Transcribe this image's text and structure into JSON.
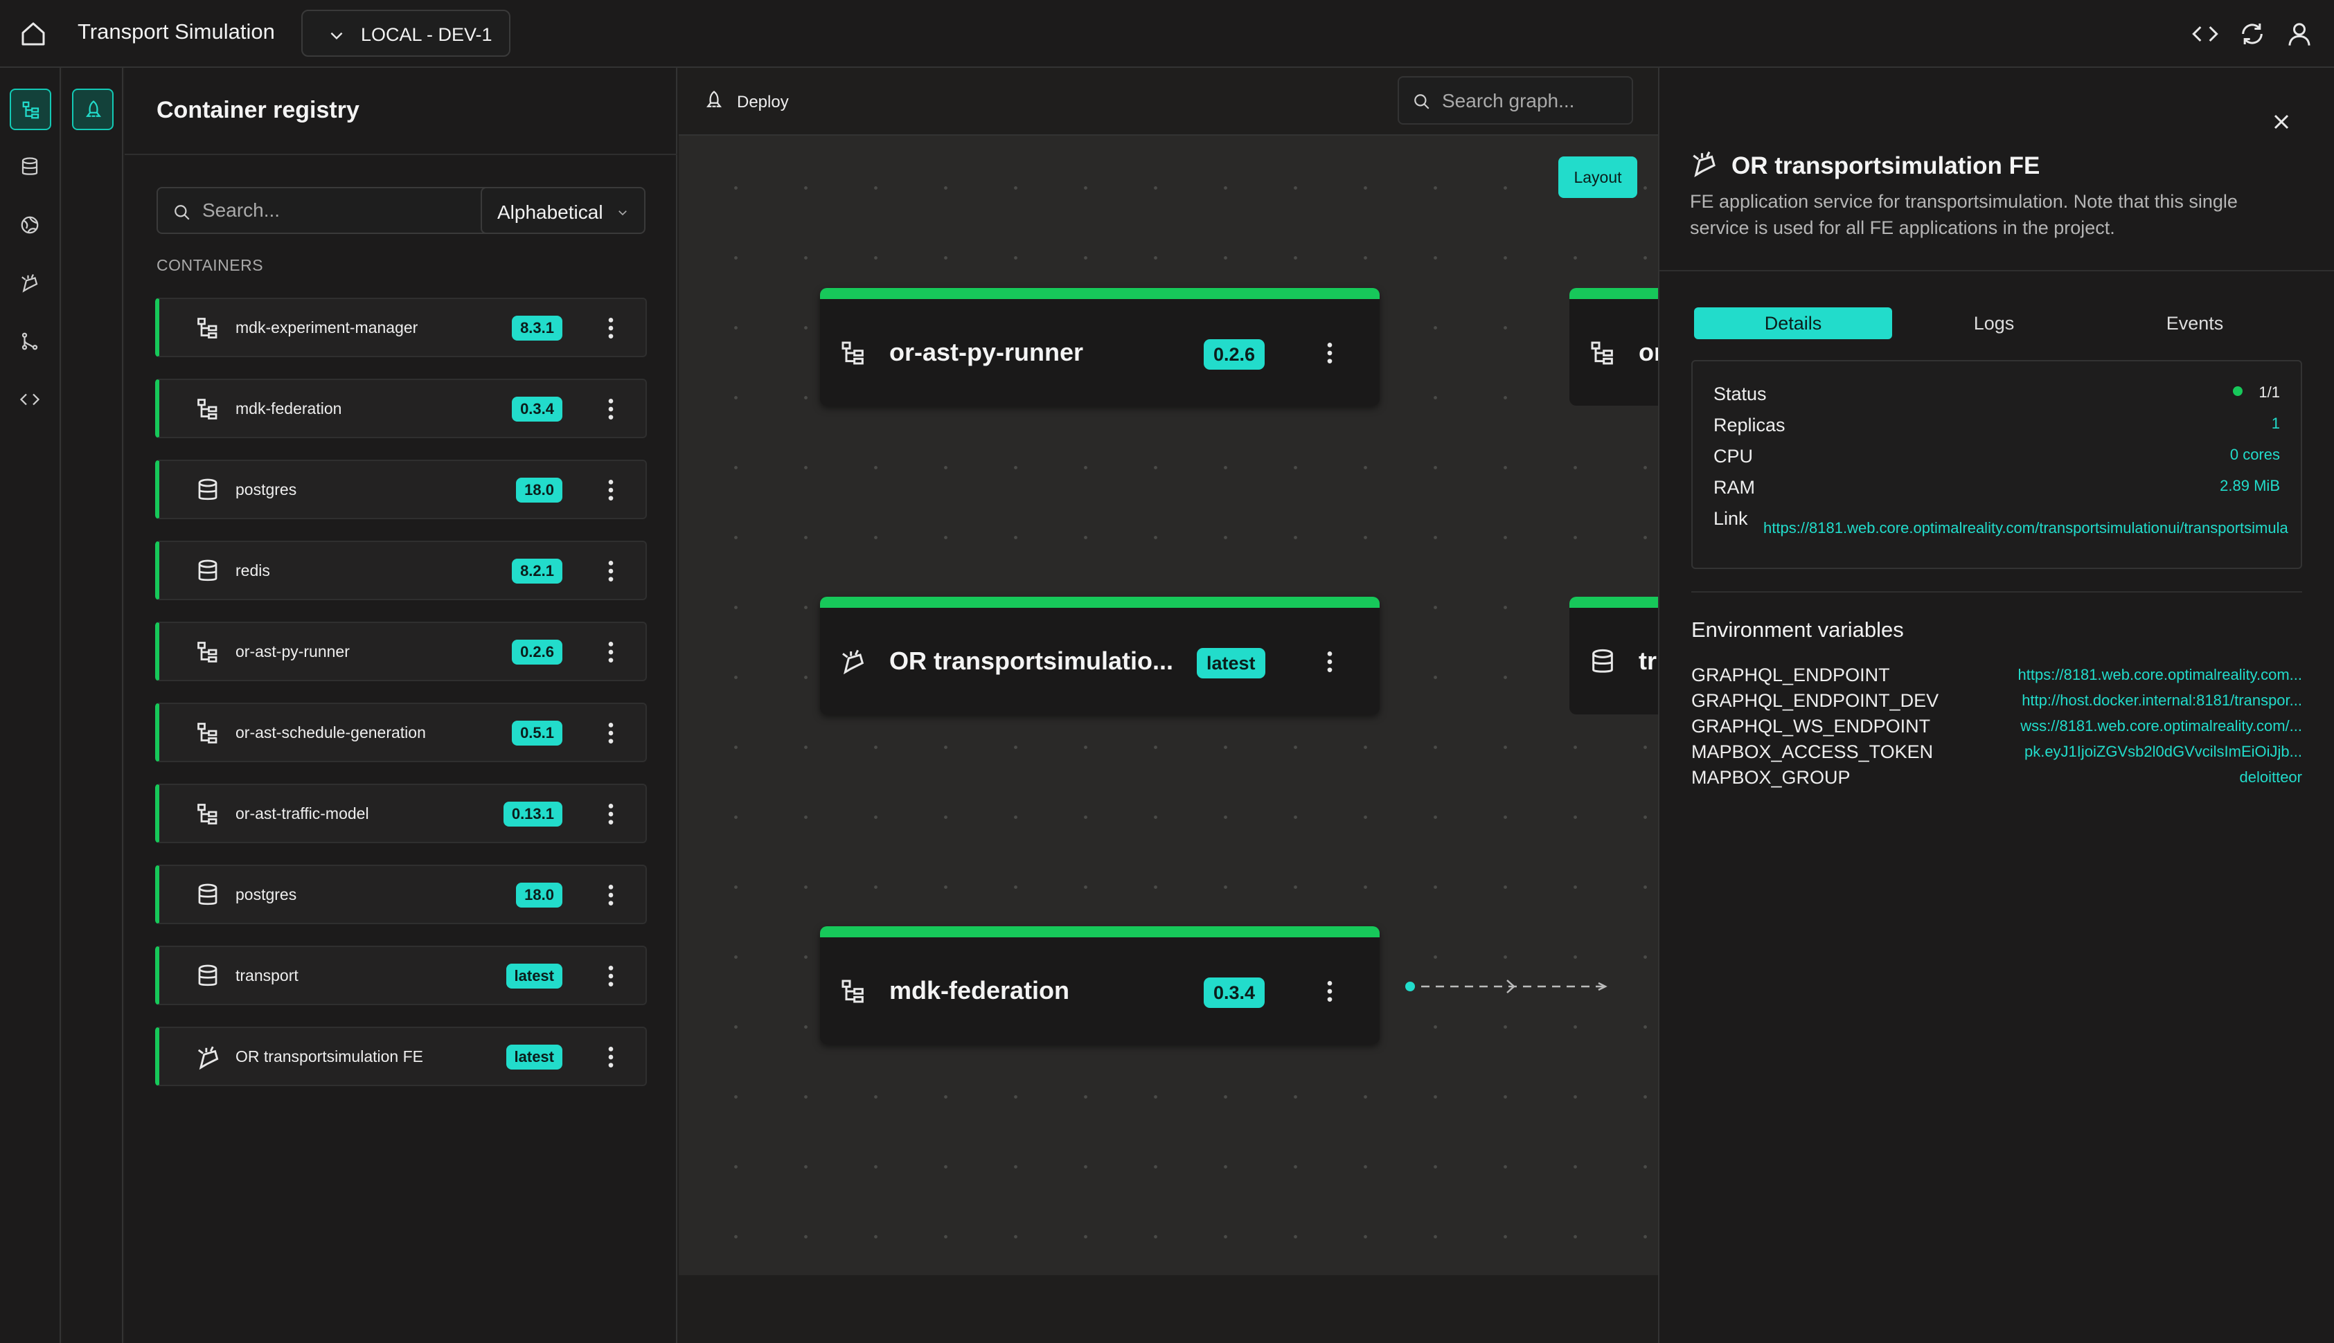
{
  "topbar": {
    "app_title": "Transport Simulation",
    "environment": "LOCAL - DEV-1"
  },
  "registry": {
    "title": "Container registry",
    "search_placeholder": "Search...",
    "sort": "Alphabetical",
    "section_label": "CONTAINERS",
    "items": [
      {
        "name": "mdk-experiment-manager",
        "version": "8.3.1",
        "icon": "hierarchy-icon"
      },
      {
        "name": "mdk-federation",
        "version": "0.3.4",
        "icon": "hierarchy-icon"
      },
      {
        "name": "postgres",
        "version": "18.0",
        "icon": "database-icon"
      },
      {
        "name": "redis",
        "version": "8.2.1",
        "icon": "database-icon"
      },
      {
        "name": "or-ast-py-runner",
        "version": "0.2.6",
        "icon": "hierarchy-icon"
      },
      {
        "name": "or-ast-schedule-generation",
        "version": "0.5.1",
        "icon": "hierarchy-icon"
      },
      {
        "name": "or-ast-traffic-model",
        "version": "0.13.1",
        "icon": "hierarchy-icon"
      },
      {
        "name": "postgres",
        "version": "18.0",
        "icon": "database-icon"
      },
      {
        "name": "transport",
        "version": "latest",
        "icon": "database-icon"
      },
      {
        "name": "OR transportsimulation FE",
        "version": "latest",
        "icon": "frontend-icon"
      }
    ]
  },
  "canvas": {
    "deploy_label": "Deploy",
    "search_placeholder": "Search graph...",
    "layout_label": "Layout",
    "nodes": [
      {
        "name": "or-ast-py-runner",
        "version": "0.2.6"
      },
      {
        "name": "OR transportsimulatio...",
        "version": "latest"
      },
      {
        "name": "mdk-federation",
        "version": "0.3.4"
      }
    ],
    "partial_nodes": [
      {
        "name": "or"
      },
      {
        "name": "tr"
      }
    ]
  },
  "details": {
    "title": "OR transportsimulation FE",
    "description": "FE application service for transportsimulation. Note that this single service is used for all FE applications in the project.",
    "tabs": [
      "Details",
      "Logs",
      "Events"
    ],
    "status": {
      "status_label": "Status",
      "status_value": "1/1",
      "replicas_label": "Replicas",
      "replicas_value": "1",
      "cpu_label": "CPU",
      "cpu_value": "0 cores",
      "ram_label": "RAM",
      "ram_value": "2.89 MiB",
      "link_label": "Link",
      "link_value": "https://8181.web.core.optimalreality.com/transportsimulationui/transportsimula"
    },
    "env_title": "Environment variables",
    "env": [
      {
        "key": "GRAPHQL_ENDPOINT",
        "value": "https://8181.web.core.optimalreality.com..."
      },
      {
        "key": "GRAPHQL_ENDPOINT_DEV",
        "value": "http://host.docker.internal:8181/transpor..."
      },
      {
        "key": "GRAPHQL_WS_ENDPOINT",
        "value": "wss://8181.web.core.optimalreality.com/..."
      },
      {
        "key": "MAPBOX_ACCESS_TOKEN",
        "value": "pk.eyJ1IjoiZGVsb2l0dGVvcilsImEiOiJjb..."
      },
      {
        "key": "MAPBOX_GROUP",
        "value": "deloitteor"
      }
    ]
  },
  "colors": {
    "accent": "#22dccb",
    "status_green": "#17c85a",
    "background": "#1c1b1b"
  }
}
